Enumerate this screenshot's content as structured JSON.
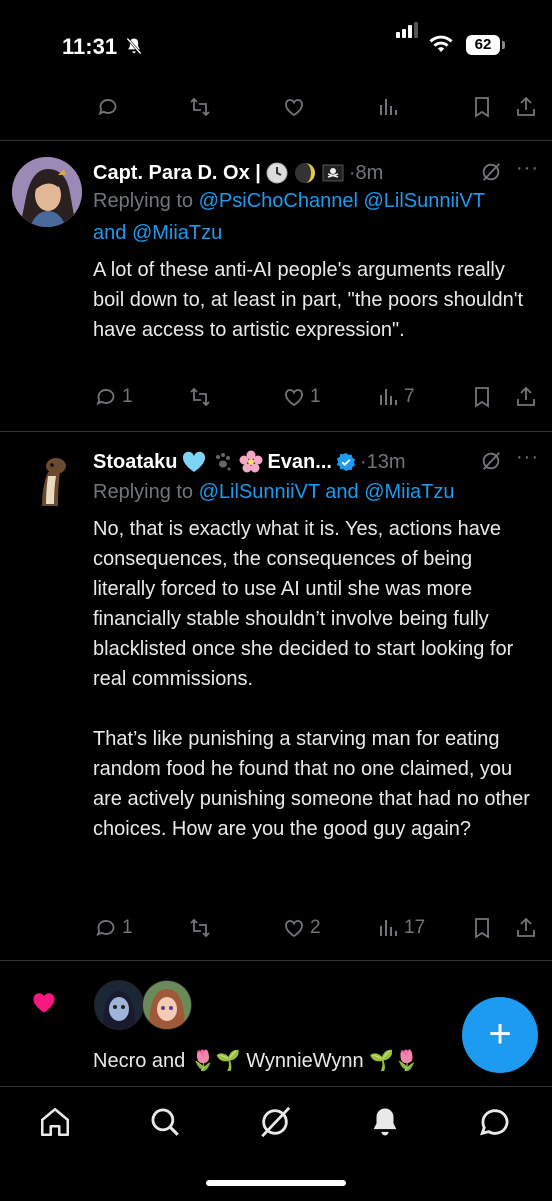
{
  "status_bar": {
    "time": "11:31",
    "battery": "62"
  },
  "tweets": [
    {
      "author": "Capt. Para D. Ox |",
      "time_ago": "·8m",
      "reply_prefix": "Replying to ",
      "reply_mentions": "@PsiChoChannel @LilSunniiVT",
      "reply_and": "and ",
      "reply_last": "@MiiaTzu",
      "text": "A lot of these anti-AI people's arguments really boil down to, at least in part, \"the poors shouldn't have access to artistic expression\".",
      "replies": "1",
      "likes": "1",
      "views": "7"
    },
    {
      "author": "Stoataku",
      "author_suffix": "Evan...",
      "time_ago": "·13m",
      "reply_prefix": "Replying to ",
      "reply_mentions": "@LilSunniiVT and @MiiaTzu",
      "text": "No, that is exactly what it is. Yes, actions have consequences, the consequences of being literally forced to use AI until she was more financially stable shouldn’t involve being fully blacklisted once she decided to start looking for real commissions.\n\nThat’s like punishing a starving man for eating random food he found that no one claimed, you are actively punishing someone that had no other choices. How are you the good guy again?",
      "replies": "1",
      "likes": "2",
      "views": "17"
    }
  ],
  "liked_notice": {
    "text": "Necro and 🌷🌱 WynnieWynn 🌱🌷"
  },
  "icons": {
    "more": "more-icon",
    "grok": "grok-icon",
    "compose": "plus-icon"
  }
}
